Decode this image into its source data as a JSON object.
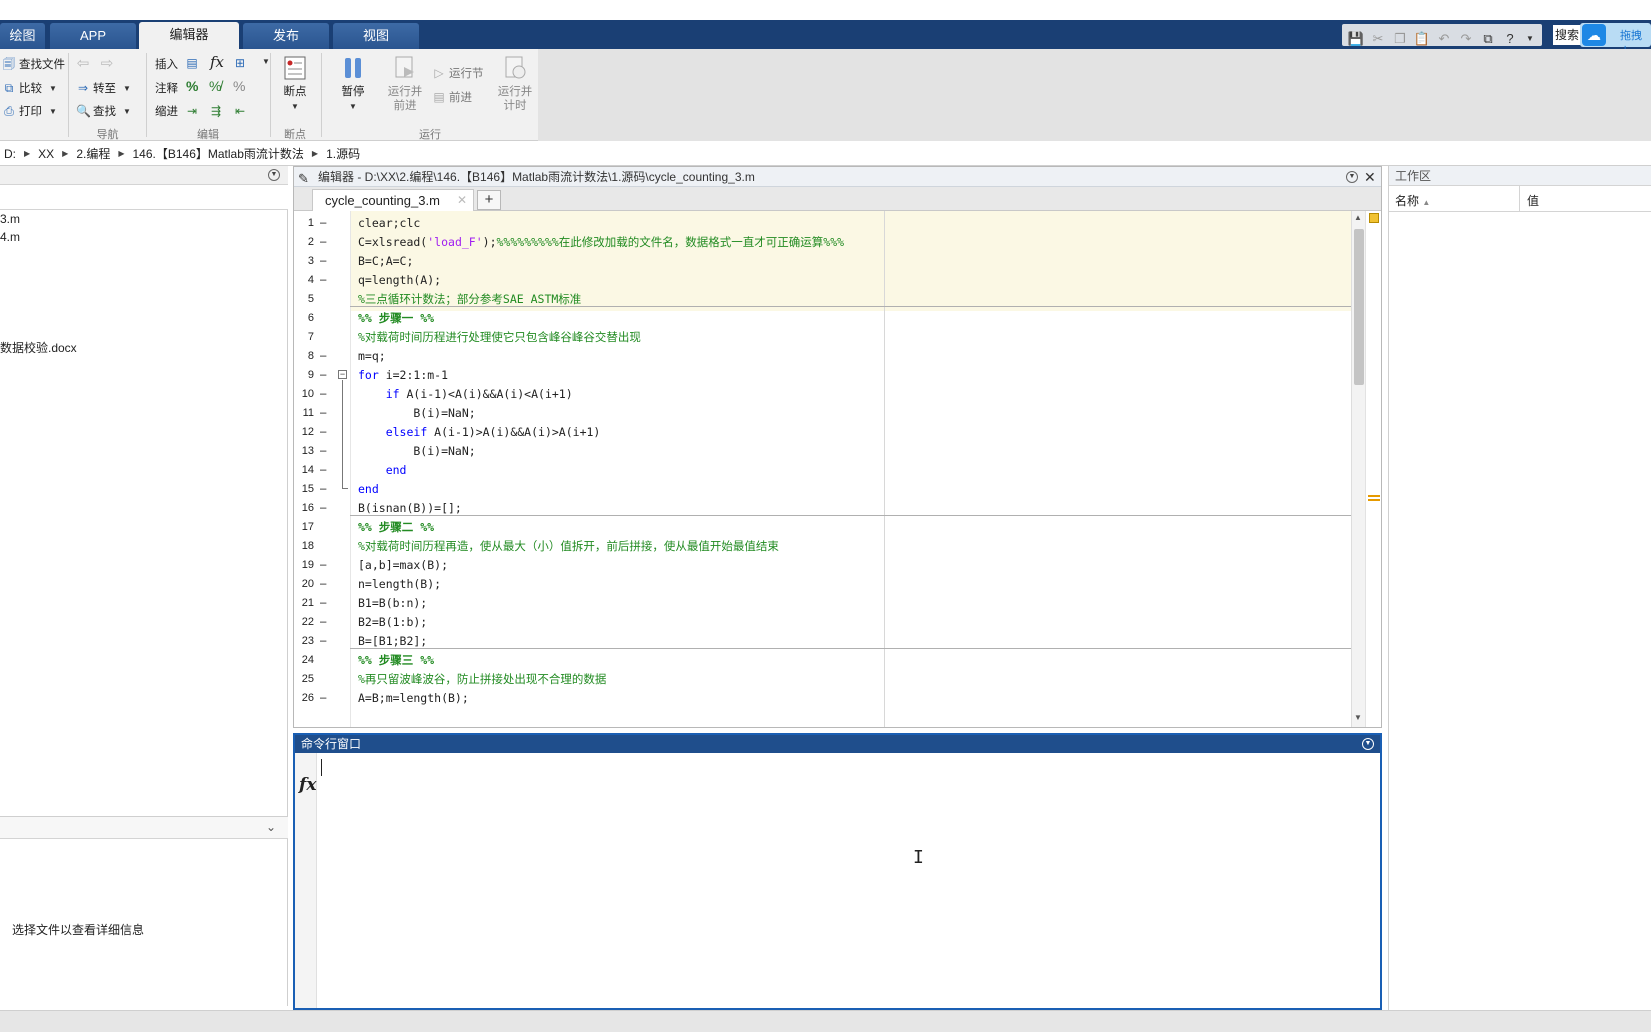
{
  "ribbon_tabs": [
    "绘图",
    "APP",
    "编辑器",
    "发布",
    "视图"
  ],
  "active_tab": "编辑器",
  "quick_access": {
    "search_label": "搜索",
    "cloud_text": "拖拽上"
  },
  "ribbon": {
    "file_group": {
      "find_files": "查找文件",
      "compare": "比较",
      "print": "打印"
    },
    "nav_group": {
      "label": "导航",
      "goto": "转至",
      "find": "查找"
    },
    "edit_group": {
      "label": "编辑",
      "insert": "插入",
      "comment": "注释",
      "indent": "缩进",
      "fx_glyph": "fx"
    },
    "breakpoints_group": {
      "label": "断点",
      "breakpoints": "断点"
    },
    "run_group": {
      "label": "运行",
      "pause": "暂停",
      "run_advance_1": "运行并",
      "run_advance_2": "前进",
      "run_section": "运行节",
      "advance": "前进",
      "run_time_1": "运行并",
      "run_time_2": "计时"
    }
  },
  "breadcrumb": [
    "D:",
    "XX",
    "2.编程",
    "146.【B146】Matlab雨流计数法",
    "1.源码"
  ],
  "left_panel": {
    "files": [
      "3.m",
      "4.m",
      "数据校验.docx"
    ],
    "details_hint": "选择文件以查看详细信息"
  },
  "editor": {
    "title": "编辑器 - D:\\XX\\2.编程\\146.【B146】Matlab雨流计数法\\1.源码\\cycle_counting_3.m",
    "tab_name": "cycle_counting_3.m",
    "lines": [
      {
        "n": "1",
        "bp": "–",
        "text": "clear;clc"
      },
      {
        "n": "2",
        "bp": "–",
        "text": "C=xlsread('load_F');%%%%%%%%%在此修改加载的文件名，数据格式一直才可正确运算%%%"
      },
      {
        "n": "3",
        "bp": "–",
        "text": "B=C;A=C;"
      },
      {
        "n": "4",
        "bp": "–",
        "text": "q=length(A);"
      },
      {
        "n": "5",
        "bp": "",
        "text": "%三点循环计数法；部分参考SAE ASTM标准"
      },
      {
        "n": "6",
        "bp": "",
        "text": "%% 步骤一 %%"
      },
      {
        "n": "7",
        "bp": "",
        "text": "%对载荷时间历程进行处理使它只包含峰谷峰谷交替出现"
      },
      {
        "n": "8",
        "bp": "–",
        "text": "m=q;"
      },
      {
        "n": "9",
        "bp": "–",
        "text": "for i=2:1:m-1"
      },
      {
        "n": "10",
        "bp": "–",
        "text": "    if A(i-1)<A(i)&&A(i)<A(i+1)"
      },
      {
        "n": "11",
        "bp": "–",
        "text": "        B(i)=NaN;"
      },
      {
        "n": "12",
        "bp": "–",
        "text": "    elseif A(i-1)>A(i)&&A(i)>A(i+1)"
      },
      {
        "n": "13",
        "bp": "–",
        "text": "        B(i)=NaN;"
      },
      {
        "n": "14",
        "bp": "–",
        "text": "    end"
      },
      {
        "n": "15",
        "bp": "–",
        "text": "end"
      },
      {
        "n": "16",
        "bp": "–",
        "text": "B(isnan(B))=[];"
      },
      {
        "n": "17",
        "bp": "",
        "text": "%% 步骤二 %%"
      },
      {
        "n": "18",
        "bp": "",
        "text": "%对载荷时间历程再造，使从最大（小）值拆开，前后拼接，使从最值开始最值结束"
      },
      {
        "n": "19",
        "bp": "–",
        "text": "[a,b]=max(B);"
      },
      {
        "n": "20",
        "bp": "–",
        "text": "n=length(B);"
      },
      {
        "n": "21",
        "bp": "–",
        "text": "B1=B(b:n);"
      },
      {
        "n": "22",
        "bp": "–",
        "text": "B2=B(1:b);"
      },
      {
        "n": "23",
        "bp": "–",
        "text": "B=[B1;B2];"
      },
      {
        "n": "24",
        "bp": "",
        "text": "%% 步骤三 %%"
      },
      {
        "n": "25",
        "bp": "",
        "text": "%再只留波峰波谷，防止拼接处出现不合理的数据"
      },
      {
        "n": "26",
        "bp": "–",
        "text": "A=B;m=length(B);"
      }
    ]
  },
  "command_window": {
    "title": "命令行窗口",
    "prompt_glyph": "fx"
  },
  "workspace": {
    "title": "工作区",
    "col_name": "名称",
    "col_value": "值"
  }
}
